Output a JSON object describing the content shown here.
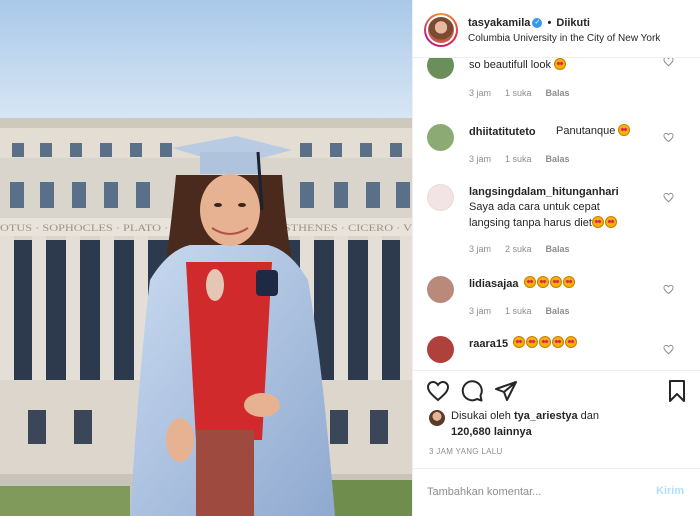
{
  "header": {
    "username": "tasyakamila",
    "verified_icon": "verified-badge-icon",
    "separator": "•",
    "follow_status": "Diikuti",
    "location": "Columbia University in the City of New York"
  },
  "building": {
    "frieze_text": "OTUS · SOPHOCLES · PLATO · ARISTOTLE · DEMOSTHENES · CICERO · V"
  },
  "comments": [
    {
      "username": "",
      "text": "so beautifull look",
      "emoji_count": 1,
      "time": "3 jam",
      "likes": "1 suka",
      "reply": "Balas",
      "avatar_color": "#6b8f5a"
    },
    {
      "username": "dhiitatituteto",
      "text": "Panutanque",
      "emoji_count": 1,
      "time": "3 jam",
      "likes": "1 suka",
      "reply": "Balas",
      "avatar_color": "#8cab74"
    },
    {
      "username": "langsingdalam_hitunganhari",
      "text_line1": "Saya ada cara untuk cepat",
      "text_line2": "langsing tanpa harus diet",
      "emoji_count": 2,
      "time": "3 jam",
      "likes": "2 suka",
      "reply": "Balas",
      "avatar_color": "#f2e4e4"
    },
    {
      "username": "lidiasajaa",
      "text": "",
      "emoji_count": 4,
      "time": "3 jam",
      "likes": "1 suka",
      "reply": "Balas",
      "avatar_color": "#b98a7a"
    },
    {
      "username": "raara15",
      "text": "",
      "emoji_count": 5,
      "time": "",
      "likes": "",
      "reply": "",
      "avatar_color": "#b0403c"
    }
  ],
  "actions": {
    "like_icon": "heart-icon",
    "comment_icon": "comment-bubble-icon",
    "share_icon": "paper-plane-icon",
    "save_icon": "bookmark-icon"
  },
  "likes": {
    "prefix": "Disukai oleh",
    "liker": "tya_ariestya",
    "conjunction": "dan",
    "count": "120,680 lainnya"
  },
  "time_ago": "3 JAM YANG LALU",
  "add_comment": {
    "placeholder": "Tambahkan komentar...",
    "post_label": "Kirim"
  },
  "colors": {
    "accent": "#3897f0",
    "post_disabled": "#b2dffc",
    "meta_text": "#8e8e8e"
  }
}
